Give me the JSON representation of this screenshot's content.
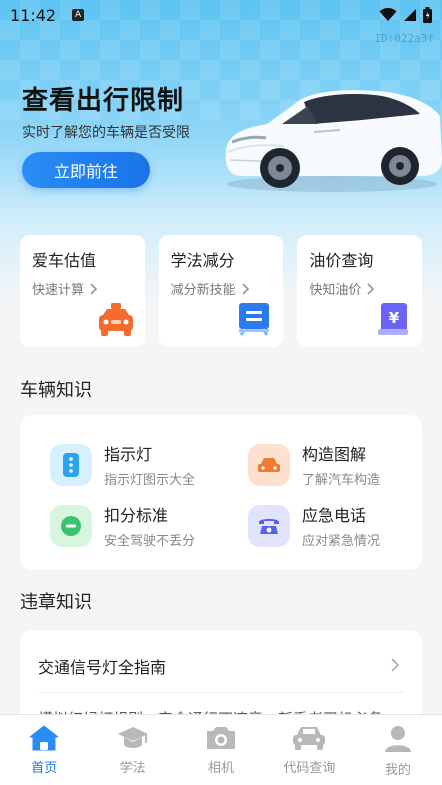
{
  "status": {
    "time": "11:42",
    "badge": "A"
  },
  "hero": {
    "id_text": "ID:022a3f",
    "title": "查看出行限制",
    "subtitle": "实时了解您的车辆是否受限",
    "button": "立即前往"
  },
  "cards": [
    {
      "title": "爱车估值",
      "sub": "快速计算",
      "icon": "taxi-icon",
      "color": "#f56a2e"
    },
    {
      "title": "学法减分",
      "sub": "减分新技能",
      "icon": "board-icon",
      "color": "#2b7bf0"
    },
    {
      "title": "油价查询",
      "sub": "快知油价",
      "icon": "yuan-icon",
      "color": "#6b63f5"
    }
  ],
  "sections": {
    "knowledge": "车辆知识",
    "violation": "违章知识"
  },
  "knowledge": [
    {
      "title": "指示灯",
      "sub": "指示灯图示大全",
      "icon": "info-icon",
      "bg": "#d7f0fd",
      "fg": "#2aa3f0"
    },
    {
      "title": "构造图解",
      "sub": "了解汽车构造",
      "icon": "car-icon",
      "bg": "#fde0cf",
      "fg": "#f07a35"
    },
    {
      "title": "扣分标准",
      "sub": "安全驾驶不丢分",
      "icon": "minus-icon",
      "bg": "#d8f5e0",
      "fg": "#3cc26a"
    },
    {
      "title": "应急电话",
      "sub": "应对紧急情况",
      "icon": "phone-icon",
      "bg": "#e2e3fd",
      "fg": "#5b5ff0"
    }
  ],
  "violation": {
    "item1": "交通信号灯全指南",
    "item2_partial": "模拟红绿灯规则，安全通行不违章，新手老司机必备"
  },
  "tabs": [
    {
      "label": "首页",
      "icon": "home-icon",
      "active": true
    },
    {
      "label": "学法",
      "icon": "graduation-cap-icon",
      "active": false
    },
    {
      "label": "相机",
      "icon": "camera-icon",
      "active": false
    },
    {
      "label": "代码查询",
      "icon": "car-front-icon",
      "active": false
    },
    {
      "label": "我的",
      "icon": "user-icon",
      "active": false
    }
  ]
}
